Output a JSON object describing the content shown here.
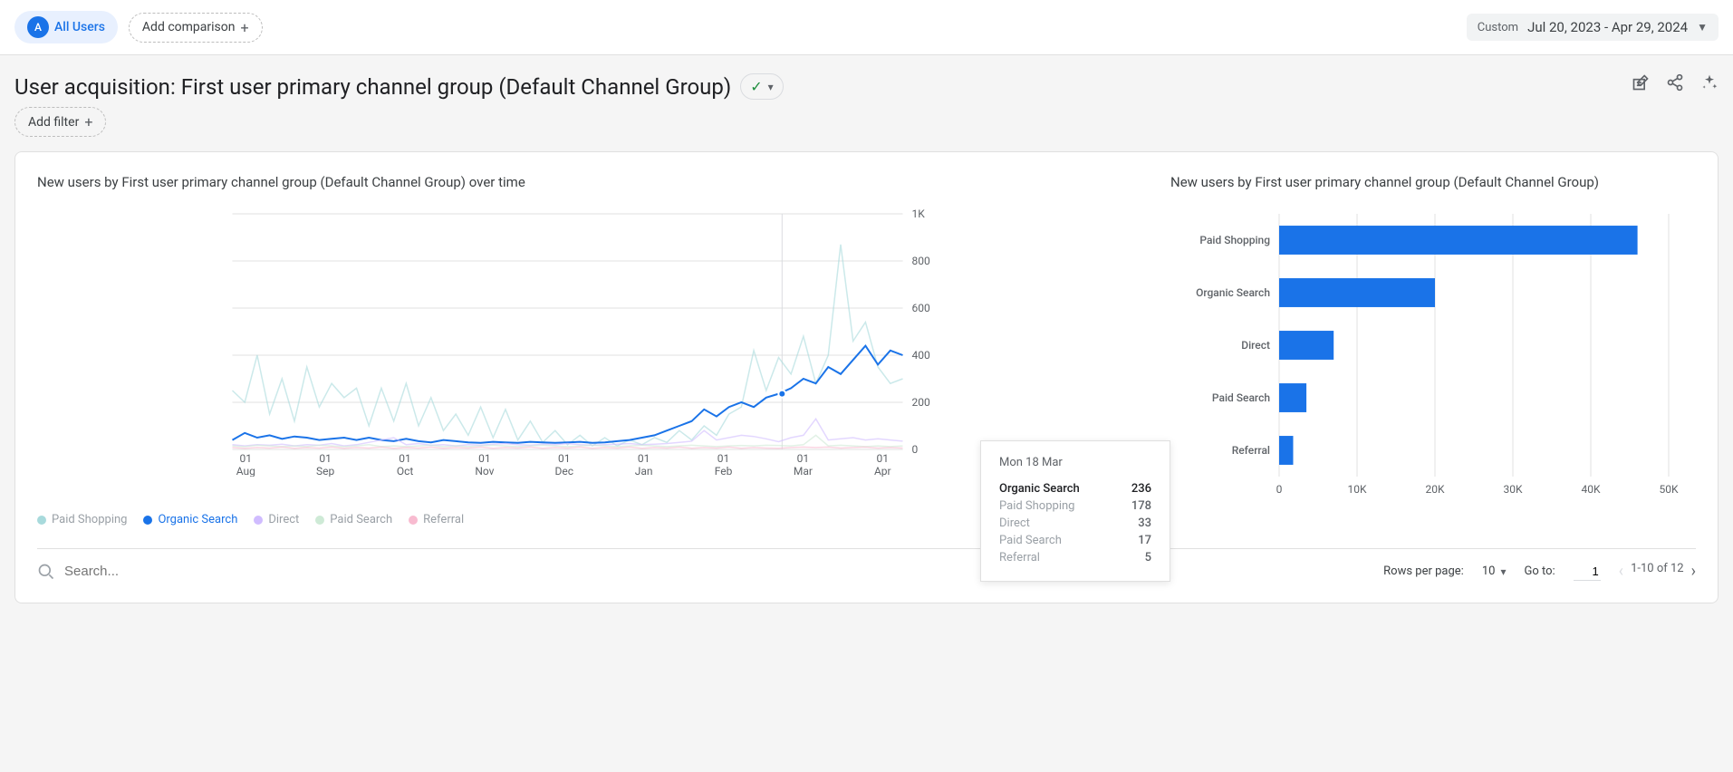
{
  "topbar": {
    "audience_badge": "A",
    "audience_label": "All Users",
    "add_comparison": "Add comparison",
    "date_custom": "Custom",
    "date_range": "Jul 20, 2023 - Apr 29, 2024"
  },
  "header": {
    "title": "User acquisition: First user primary channel group (Default Channel Group)",
    "add_filter": "Add filter"
  },
  "charts": {
    "line_title": "New users by First user primary channel group (Default Channel Group) over time",
    "bar_title": "New users by First user primary channel group (Default Channel Group)"
  },
  "legend": {
    "paid_shopping": "Paid Shopping",
    "organic_search": "Organic Search",
    "direct": "Direct",
    "paid_search": "Paid Search",
    "referral": "Referral"
  },
  "tooltip": {
    "date": "Mon 18 Mar",
    "rows": {
      "organic_search": {
        "label": "Organic Search",
        "value": "236"
      },
      "paid_shopping": {
        "label": "Paid Shopping",
        "value": "178"
      },
      "direct": {
        "label": "Direct",
        "value": "33"
      },
      "paid_search": {
        "label": "Paid Search",
        "value": "17"
      },
      "referral": {
        "label": "Referral",
        "value": "5"
      }
    }
  },
  "table": {
    "search_placeholder": "Search...",
    "rows_per_page_label": "Rows per page:",
    "rows_per_page_value": "10",
    "go_to_label": "Go to:",
    "go_to_value": "1",
    "range": "1-10 of 12"
  },
  "chart_data": [
    {
      "type": "line",
      "title": "New users by First user primary channel group (Default Channel Group) over time",
      "xlabel": "",
      "ylabel": "",
      "ylim": [
        0,
        1000
      ],
      "x_ticks": [
        "01 Aug",
        "01 Sep",
        "01 Oct",
        "01 Nov",
        "01 Dec",
        "01 Jan",
        "01 Feb",
        "01 Mar",
        "01 Apr"
      ],
      "y_ticks": [
        "0",
        "200",
        "400",
        "600",
        "800",
        "1K"
      ],
      "series": [
        {
          "name": "Paid Shopping",
          "color": "#a8dadc",
          "active": false,
          "values": [
            250,
            200,
            400,
            150,
            300,
            120,
            350,
            180,
            280,
            220,
            260,
            100,
            260,
            120,
            280,
            100,
            220,
            80,
            150,
            60,
            180,
            50,
            170,
            40,
            120,
            30,
            80,
            20,
            60,
            15,
            50,
            15,
            40,
            20,
            50,
            30,
            80,
            40,
            100,
            60,
            150,
            180,
            420,
            250,
            390,
            320,
            480,
            280,
            400,
            870,
            460,
            540,
            350,
            280,
            300
          ]
        },
        {
          "name": "Organic Search",
          "color": "#1a73e8",
          "active": true,
          "values": [
            40,
            70,
            50,
            60,
            45,
            55,
            50,
            40,
            45,
            50,
            40,
            50,
            40,
            35,
            45,
            35,
            30,
            40,
            35,
            30,
            28,
            32,
            30,
            28,
            32,
            30,
            28,
            30,
            32,
            28,
            30,
            35,
            40,
            50,
            60,
            80,
            100,
            120,
            170,
            140,
            180,
            200,
            180,
            220,
            236,
            260,
            300,
            280,
            350,
            320,
            380,
            440,
            360,
            420,
            400
          ]
        },
        {
          "name": "Direct",
          "color": "#d0bcff",
          "active": false,
          "values": [
            20,
            15,
            20,
            18,
            22,
            15,
            20,
            18,
            25,
            15,
            20,
            30,
            40,
            50,
            20,
            25,
            18,
            20,
            15,
            20,
            18,
            22,
            25,
            20,
            18,
            22,
            20,
            25,
            20,
            18,
            20,
            22,
            25,
            20,
            22,
            25,
            30,
            35,
            80,
            40,
            50,
            60,
            55,
            45,
            33,
            50,
            60,
            130,
            40,
            45,
            50,
            40,
            45,
            40,
            35
          ]
        },
        {
          "name": "Paid Search",
          "color": "#ceead6",
          "active": false,
          "values": [
            15,
            12,
            18,
            15,
            12,
            15,
            12,
            18,
            15,
            12,
            15,
            20,
            12,
            15,
            12,
            15,
            18,
            12,
            15,
            12,
            15,
            18,
            15,
            12,
            15,
            18,
            15,
            12,
            15,
            18,
            15,
            12,
            15,
            18,
            15,
            12,
            15,
            18,
            15,
            12,
            15,
            17,
            15,
            18,
            17,
            15,
            20,
            60,
            15,
            18,
            15,
            12,
            15,
            12,
            15
          ]
        },
        {
          "name": "Referral",
          "color": "#f8bbd0",
          "active": false,
          "values": [
            8,
            5,
            8,
            6,
            10,
            5,
            8,
            6,
            10,
            5,
            8,
            6,
            10,
            5,
            8,
            6,
            10,
            5,
            8,
            6,
            10,
            5,
            8,
            6,
            10,
            5,
            8,
            6,
            10,
            5,
            8,
            6,
            10,
            5,
            8,
            6,
            10,
            5,
            8,
            6,
            10,
            5,
            8,
            6,
            5,
            8,
            10,
            8,
            10,
            6,
            8,
            10,
            6,
            8,
            6
          ]
        }
      ]
    },
    {
      "type": "bar",
      "orientation": "horizontal",
      "title": "New users by First user primary channel group (Default Channel Group)",
      "xlabel": "",
      "ylabel": "",
      "xlim": [
        0,
        50000
      ],
      "x_ticks": [
        "0",
        "10K",
        "20K",
        "30K",
        "40K",
        "50K"
      ],
      "categories": [
        "Paid Shopping",
        "Organic Search",
        "Direct",
        "Paid Search",
        "Referral"
      ],
      "values": [
        46000,
        20000,
        7000,
        3500,
        1800
      ],
      "color": "#1a73e8"
    }
  ]
}
